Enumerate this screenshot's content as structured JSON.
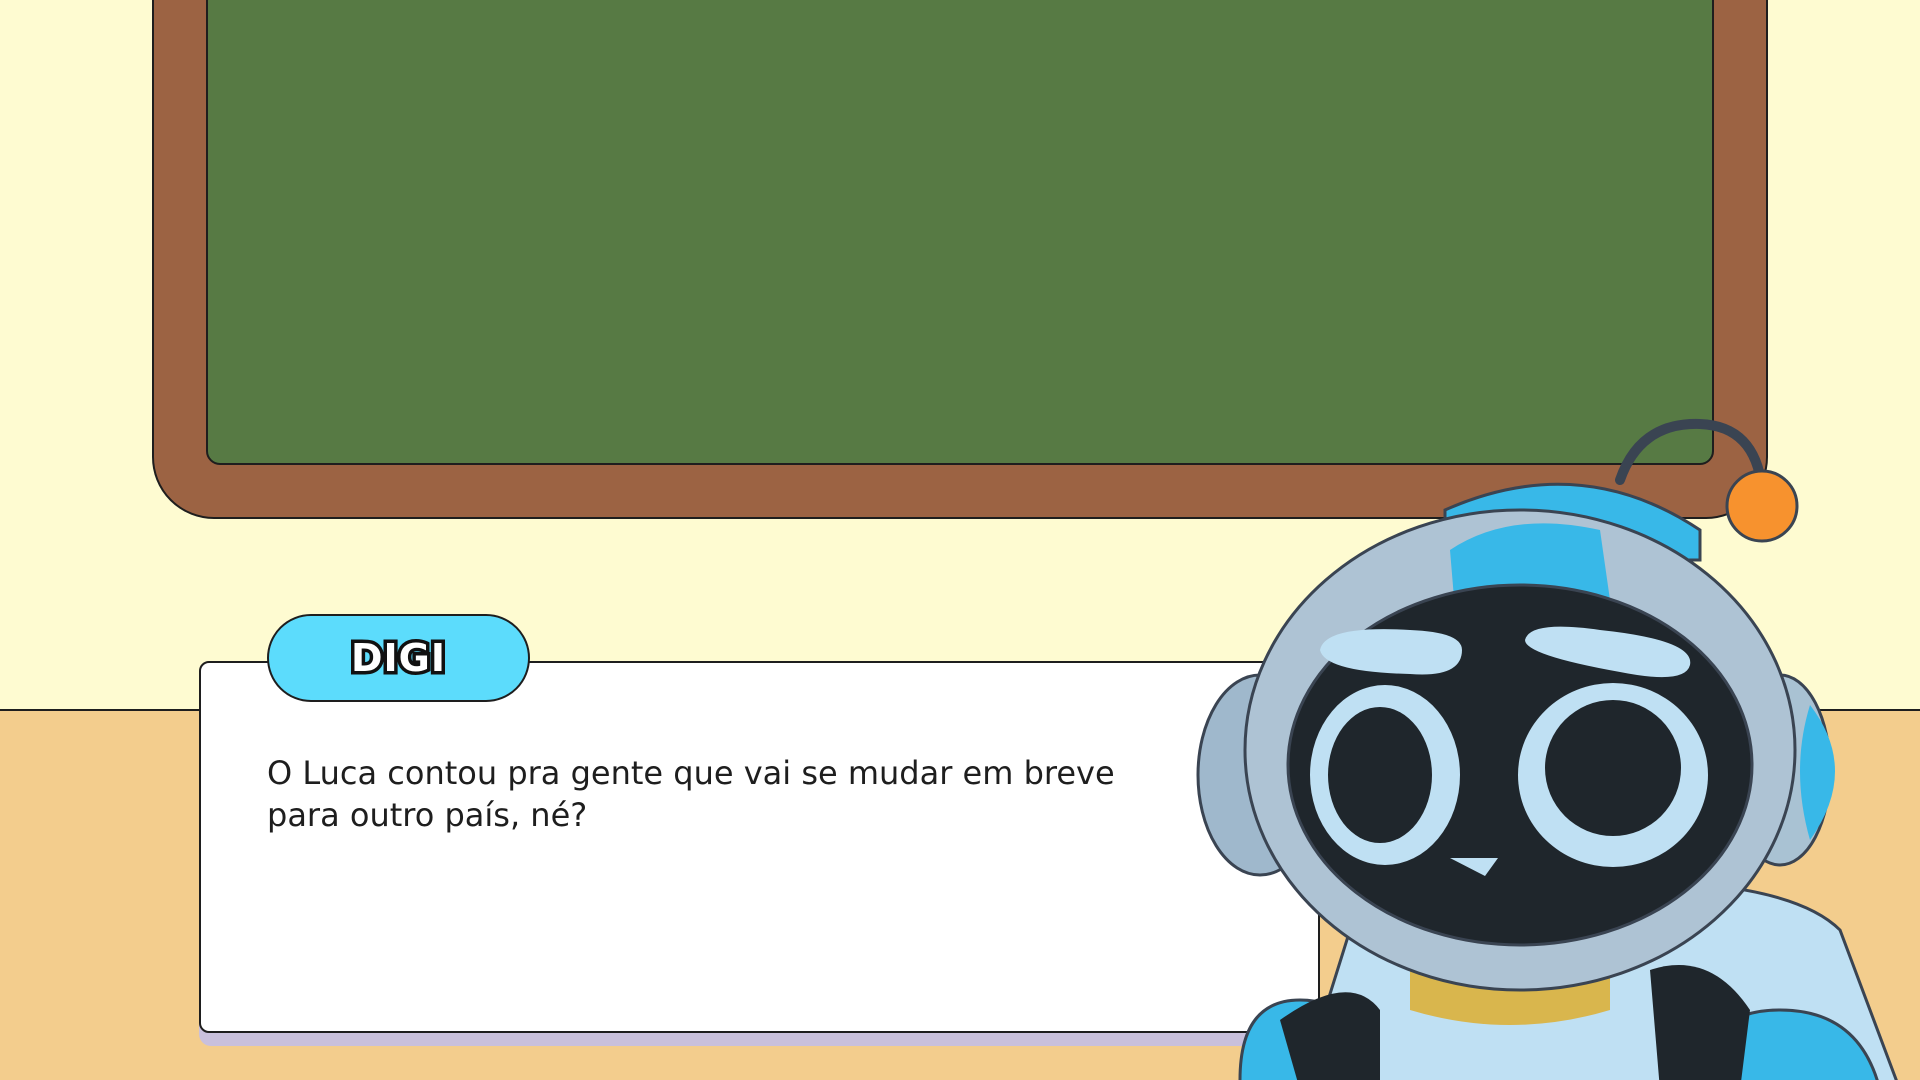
{
  "dialog": {
    "speaker": "DIGI",
    "text": "O Luca contou pra gente que vai se mudar em breve para outro país, né?"
  },
  "character": {
    "icon": "robot-character"
  },
  "colors": {
    "wall": "#fefbd1",
    "floor": "#f3cd8d",
    "board_frame": "#9c6343",
    "board_surface": "#577a44",
    "name_tag": "#5cdcfc",
    "dialog_shadow": "#c9c0dc",
    "robot_blue": "#38b8e8",
    "robot_face": "#1f262c",
    "robot_eye": "#bfe0f3",
    "antenna_ball": "#f7922e"
  }
}
